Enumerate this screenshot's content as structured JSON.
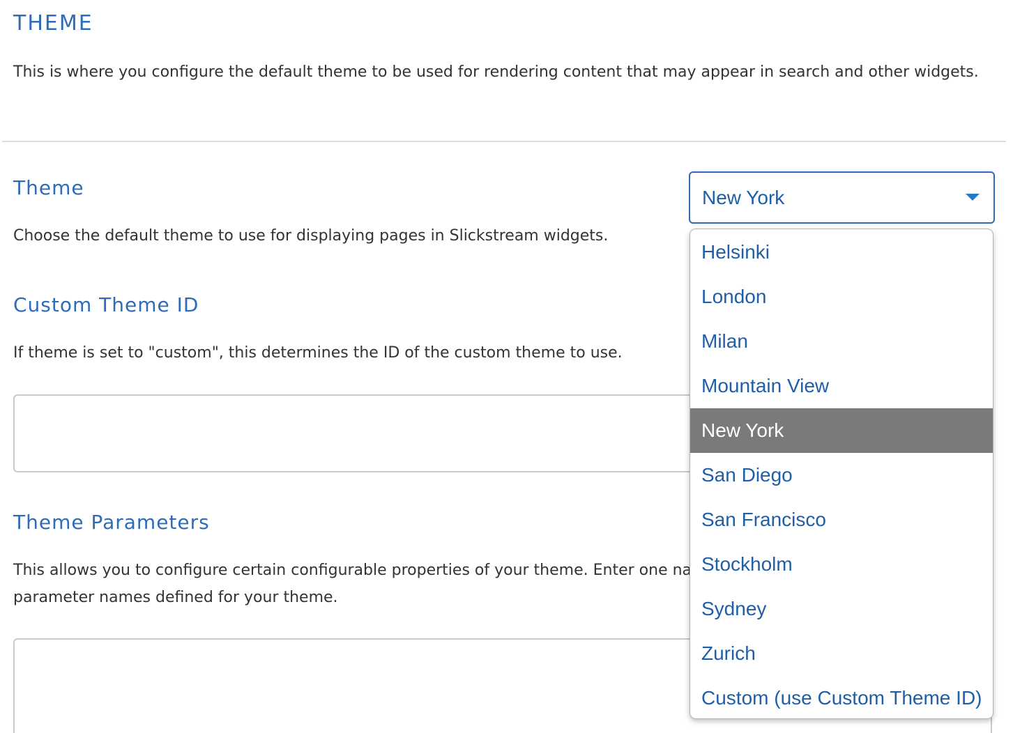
{
  "section": {
    "title": "THEME",
    "description": "This is where you configure the default theme to be used for rendering content that may appear in search and other widgets."
  },
  "theme_field": {
    "label": "Theme",
    "description": "Choose the default theme to use for displaying pages in Slickstream widgets.",
    "selected_value": "New York",
    "options": [
      "Helsinki",
      "London",
      "Milan",
      "Mountain View",
      "New York",
      "San Diego",
      "San Francisco",
      "Stockholm",
      "Sydney",
      "Zurich",
      "Custom (use Custom Theme ID)"
    ]
  },
  "custom_theme_id_field": {
    "label": "Custom Theme ID",
    "description": "If theme is set to \"custom\", this determines the ID of the custom theme to use.",
    "value": ""
  },
  "theme_parameters_field": {
    "label": "Theme Parameters",
    "description": "This allows you to configure certain configurable properties of your theme.  Enter one name=value, where name is one of the parameter names defined for your theme.",
    "value": ""
  },
  "colors": {
    "accent": "#2e6bb8",
    "text": "#333333",
    "selected_option_bg": "#7a7a7a"
  }
}
